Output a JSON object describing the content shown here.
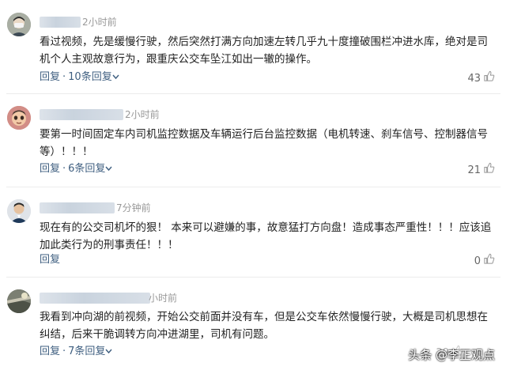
{
  "comments": [
    {
      "time": "2小时前",
      "text": "看过视频，先是缓慢行驶，然后突然打满方向加速左转几乎九十度撞破围栏冲进水库，绝对是司机个人主观故意行为，跟重庆公交车坠江如出一辙的操作。",
      "reply_label": "回复",
      "replies_label": "10条回复",
      "likes": "43"
    },
    {
      "time": "2小时前",
      "text": "要第一时间固定车内司机监控数据及车辆运行后台监控数据（电机转速、刹车信号、控制器信号等）！！！",
      "reply_label": "回复",
      "replies_label": "6条回复",
      "likes": "21"
    },
    {
      "time": "7分钟前",
      "text": "现在有的公交司机坏的狠！ 本来可以避嫌的事，故意猛打方向盘！造成事态严重性！！！应该追加此类行为的刑事责任！！！",
      "reply_label": "回复",
      "replies_label": "",
      "likes": "0"
    },
    {
      "time": "小时前",
      "text": "我看到冲向湖的前视频，开始公交前面并没有车，但是公交车依然慢慢行驶，大概是司机思想在纠结，后来干脆调转方向冲进湖里，司机有问题。",
      "reply_label": "回复",
      "replies_label": "7条回复",
      "likes": "29"
    }
  ],
  "watermark": "头条 @李正观点",
  "colors": {
    "link": "#3f5f80",
    "muted": "#999999"
  }
}
